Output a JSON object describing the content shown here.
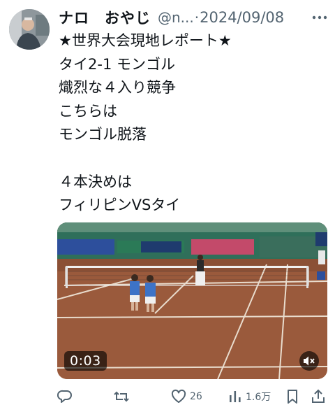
{
  "post": {
    "display_name": "ナロ　おやじ",
    "handle": "@n...",
    "separator": "·",
    "date": "2024/09/08",
    "body": "★世界大会現地レポート★\nタイ2-1 モンゴル\n熾烈な４入り競争\nこちらは\nモンゴル脱落\n\n４本決めは\nフィリピンVSタイ"
  },
  "video": {
    "timestamp": "0:03",
    "muted": true
  },
  "actions": {
    "reply_count": "",
    "repost_count": "",
    "like_count": "26",
    "views_count": "1.6万"
  },
  "icons": {
    "more": "more-horizontal-icon",
    "reply": "reply-icon",
    "repost": "repost-icon",
    "like": "heart-icon",
    "views": "views-bar-chart-icon",
    "bookmark": "bookmark-icon",
    "share": "share-icon",
    "mute": "speaker-muted-icon"
  },
  "colors": {
    "text": "#0f1419",
    "secondary": "#536471",
    "court": "#9a5a3c"
  }
}
